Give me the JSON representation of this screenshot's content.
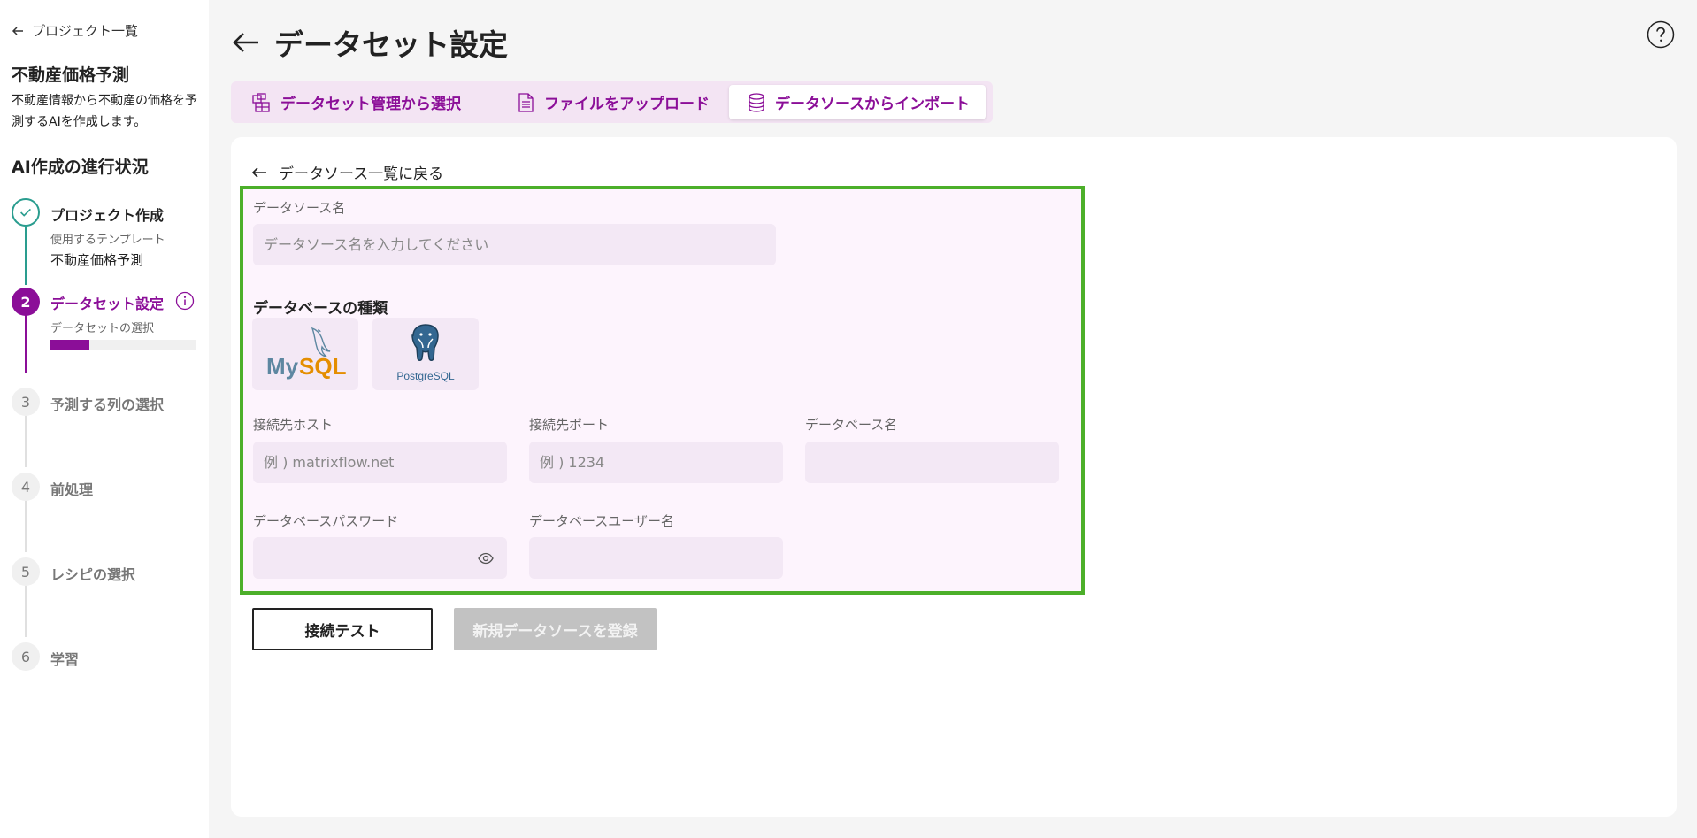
{
  "sidebar": {
    "back_label": "プロジェクト一覧",
    "project_title": "不動産価格予測",
    "project_description": "不動産情報から不動産の価格を予測するAIを作成します。",
    "progress_title": "AI作成の進行状況",
    "steps": [
      {
        "number": "✓",
        "label": "プロジェクト作成",
        "sub_label": "使用するテンプレート",
        "value": "不動産価格予測"
      },
      {
        "number": "2",
        "label": "データセット設定",
        "sub_label": "データセットの選択",
        "progress": 0.27
      },
      {
        "number": "3",
        "label": "予測する列の選択"
      },
      {
        "number": "4",
        "label": "前処理"
      },
      {
        "number": "5",
        "label": "レシピの選択"
      },
      {
        "number": "6",
        "label": "学習"
      }
    ]
  },
  "header": {
    "title": "データセット設定"
  },
  "tabs": [
    {
      "label": "データセット管理から選択",
      "icon": "dataset-manage-icon"
    },
    {
      "label": "ファイルをアップロード",
      "icon": "file-icon"
    },
    {
      "label": "データソースからインポート",
      "icon": "database-icon",
      "active": true
    }
  ],
  "form": {
    "back_label": "データソース一覧に戻る",
    "datasource_name_label": "データソース名",
    "datasource_name_placeholder": "データソース名を入力してください",
    "db_type_title": "データベースの種類",
    "db_types": [
      "MySQL",
      "PostgreSQL"
    ],
    "host_label": "接続先ホスト",
    "host_placeholder": "例 ) matrixflow.net",
    "port_label": "接続先ポート",
    "port_placeholder": "例 ) 1234",
    "dbname_label": "データベース名",
    "password_label": "データベースパスワード",
    "username_label": "データベースユーザー名"
  },
  "buttons": {
    "test_label": "接続テスト",
    "register_label": "新規データソースを登録"
  },
  "colors": {
    "accent": "#8b0e98",
    "done": "#2a9d8f",
    "highlight_border": "#4caf2a"
  }
}
